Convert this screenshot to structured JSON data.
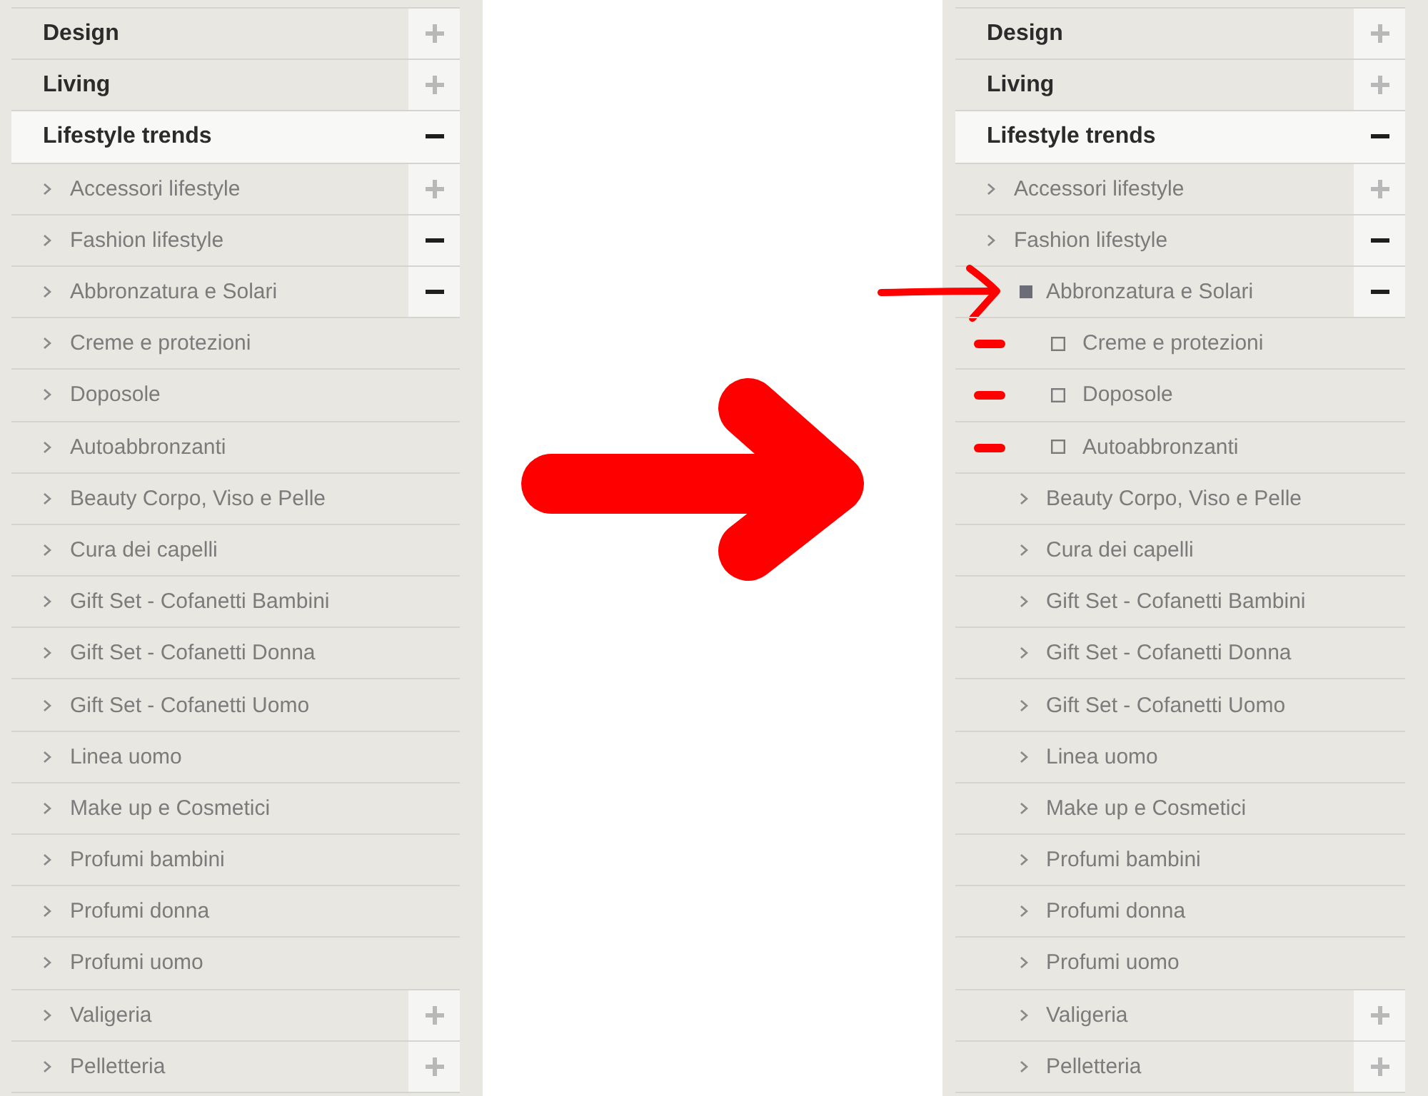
{
  "panels": [
    {
      "items": [
        {
          "label": "Design",
          "selected": false,
          "expanded": false
        },
        {
          "label": "Living",
          "selected": false,
          "expanded": false
        },
        {
          "label": "Lifestyle trends",
          "selected": true,
          "expanded": true,
          "children": [
            {
              "label": "Accessori lifestyle",
              "kind": "chevron",
              "selected": false,
              "expanded": false
            },
            {
              "label": "Fashion lifestyle",
              "kind": "chevron",
              "selected": false,
              "expanded": true
            },
            {
              "label": "Abbronzatura e Solari",
              "kind": "chevron",
              "selected": false,
              "expanded": true
            },
            {
              "label": "Creme e protezioni",
              "kind": "chevron",
              "selected": false
            },
            {
              "label": "Doposole",
              "kind": "chevron",
              "selected": false
            },
            {
              "label": "Autoabbronzanti",
              "kind": "chevron",
              "selected": false
            },
            {
              "label": "Beauty Corpo, Viso e Pelle",
              "kind": "chevron",
              "selected": false
            },
            {
              "label": "Cura dei capelli",
              "kind": "chevron",
              "selected": false
            },
            {
              "label": "Gift Set - Cofanetti Bambini",
              "kind": "chevron",
              "selected": false
            },
            {
              "label": "Gift Set - Cofanetti Donna",
              "kind": "chevron",
              "selected": false
            },
            {
              "label": "Gift Set - Cofanetti Uomo",
              "kind": "chevron",
              "selected": false
            },
            {
              "label": "Linea uomo",
              "kind": "chevron",
              "selected": false
            },
            {
              "label": "Make up e Cosmetici",
              "kind": "chevron",
              "selected": false
            },
            {
              "label": "Profumi bambini",
              "kind": "chevron",
              "selected": false
            },
            {
              "label": "Profumi donna",
              "kind": "chevron",
              "selected": false
            },
            {
              "label": "Profumi uomo",
              "kind": "chevron",
              "selected": false
            },
            {
              "label": "Valigeria",
              "kind": "chevron",
              "selected": false,
              "expanded": false
            },
            {
              "label": "Pelletteria",
              "kind": "chevron",
              "selected": false,
              "expanded": false
            }
          ]
        }
      ]
    },
    {
      "items": [
        {
          "label": "Design",
          "selected": false,
          "expanded": false
        },
        {
          "label": "Living",
          "selected": false,
          "expanded": false
        },
        {
          "label": "Lifestyle trends",
          "selected": true,
          "expanded": true,
          "children": [
            {
              "label": "Accessori lifestyle",
              "kind": "chevron",
              "selected": false,
              "expanded": false
            },
            {
              "label": "Fashion lifestyle",
              "kind": "chevron",
              "selected": false,
              "expanded": true,
              "children": [
                {
                  "label": "Abbronzatura e Solari",
                  "kind": "filled-square",
                  "selected": false,
                  "expanded": true,
                  "annotation": {
                    "kind": "arrow"
                  },
                  "children": [
                    {
                      "label": "Creme e protezioni",
                      "kind": "hollow-square",
                      "selected": false,
                      "annotation": {
                        "kind": "dash"
                      }
                    },
                    {
                      "label": "Doposole",
                      "kind": "hollow-square",
                      "selected": false,
                      "annotation": {
                        "kind": "dash"
                      }
                    },
                    {
                      "label": "Autoabbronzanti",
                      "kind": "hollow-square",
                      "selected": false,
                      "annotation": {
                        "kind": "dash"
                      }
                    }
                  ]
                },
                {
                  "label": "Beauty Corpo, Viso e Pelle",
                  "kind": "chevron",
                  "selected": false
                },
                {
                  "label": "Cura dei capelli",
                  "kind": "chevron",
                  "selected": false
                },
                {
                  "label": "Gift Set - Cofanetti Bambini",
                  "kind": "chevron",
                  "selected": false
                },
                {
                  "label": "Gift Set - Cofanetti Donna",
                  "kind": "chevron",
                  "selected": false
                },
                {
                  "label": "Gift Set - Cofanetti Uomo",
                  "kind": "chevron",
                  "selected": false
                },
                {
                  "label": "Linea uomo",
                  "kind": "chevron",
                  "selected": false
                },
                {
                  "label": "Make up e Cosmetici",
                  "kind": "chevron",
                  "selected": false
                },
                {
                  "label": "Profumi bambini",
                  "kind": "chevron",
                  "selected": false
                },
                {
                  "label": "Profumi donna",
                  "kind": "chevron",
                  "selected": false
                },
                {
                  "label": "Profumi uomo",
                  "kind": "chevron",
                  "selected": false
                },
                {
                  "label": "Valigeria",
                  "kind": "chevron",
                  "selected": false,
                  "expanded": false
                },
                {
                  "label": "Pelletteria",
                  "kind": "chevron",
                  "selected": false,
                  "expanded": false
                }
              ]
            }
          ]
        }
      ]
    }
  ]
}
